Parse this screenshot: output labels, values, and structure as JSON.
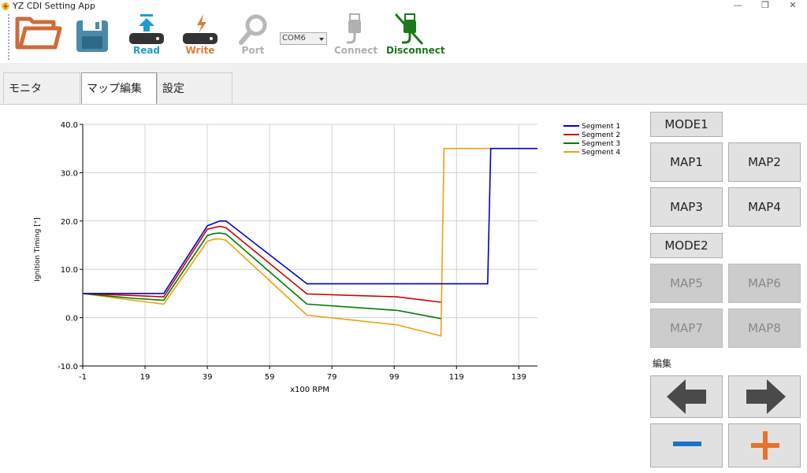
{
  "window": {
    "title": "YZ CDI Setting App",
    "minimize": "—",
    "restore": "❐",
    "close": "✕"
  },
  "toolbar": {
    "read_label": "Read",
    "write_label": "Write",
    "port_label": "Port",
    "com_value": "COM6",
    "connect_label": "Connect",
    "disconnect_label": "Disconnect",
    "colors": {
      "read": "#1e9ad6",
      "write": "#e07b39",
      "disabled": "#b0b0b0",
      "disconnect": "#1a7a1a"
    }
  },
  "tabs": [
    {
      "label": "モニタ",
      "active": false
    },
    {
      "label": "マップ編集",
      "active": true
    },
    {
      "label": "設定",
      "active": false
    }
  ],
  "chart_data": {
    "type": "line",
    "xlabel": "x100 RPM",
    "ylabel": "Ignition Timing [°]",
    "xlim": [
      -1,
      145
    ],
    "ylim": [
      -10,
      40
    ],
    "x_ticks": [
      -1,
      19,
      39,
      59,
      79,
      99,
      119,
      139
    ],
    "y_ticks": [
      -10,
      0,
      10,
      20,
      30,
      40
    ],
    "y_tick_labels": [
      "-10.0",
      "0.0",
      "10.0",
      "20.0",
      "30.0",
      "40.0"
    ],
    "grid": true,
    "legend_position": "top-right",
    "series": [
      {
        "name": "Segment 1",
        "color": "#0000cc",
        "x": [
          -1,
          15,
          25,
          39,
          41,
          43,
          45,
          71,
          129,
          130,
          132,
          145
        ],
        "y": [
          5,
          5,
          5,
          19,
          19.5,
          20,
          20,
          7,
          7,
          35,
          35,
          35
        ]
      },
      {
        "name": "Segment 2",
        "color": "#cc0000",
        "x": [
          -1,
          15,
          25,
          39,
          41,
          43,
          45,
          71,
          100,
          114
        ],
        "y": [
          5,
          4.6,
          4.3,
          18.3,
          18.6,
          18.9,
          18.6,
          4.9,
          4.3,
          3.2
        ]
      },
      {
        "name": "Segment 3",
        "color": "#007a00",
        "x": [
          -1,
          15,
          25,
          39,
          41,
          43,
          45,
          71,
          100,
          114
        ],
        "y": [
          5,
          4.0,
          3.6,
          17.0,
          17.4,
          17.5,
          17.3,
          2.8,
          1.5,
          -0.2
        ]
      },
      {
        "name": "Segment 4",
        "color": "#f0a010",
        "x": [
          -1,
          15,
          25,
          39,
          41,
          43,
          45,
          71,
          100,
          114,
          115,
          145
        ],
        "y": [
          5,
          3.6,
          2.8,
          15.8,
          16.2,
          16.3,
          16.0,
          0.5,
          -1.5,
          -3.8,
          35,
          35
        ]
      }
    ]
  },
  "panel": {
    "mode1": "MODE1",
    "map1": "MAP1",
    "map2": "MAP2",
    "map3": "MAP3",
    "map4": "MAP4",
    "mode2": "MODE2",
    "map5": "MAP5",
    "map6": "MAP6",
    "map7": "MAP7",
    "map8": "MAP8",
    "edit_label": "編集",
    "icon_colors": {
      "arrow": "#4a4a4a",
      "minus": "#1a72c4",
      "plus": "#e8712a"
    }
  }
}
